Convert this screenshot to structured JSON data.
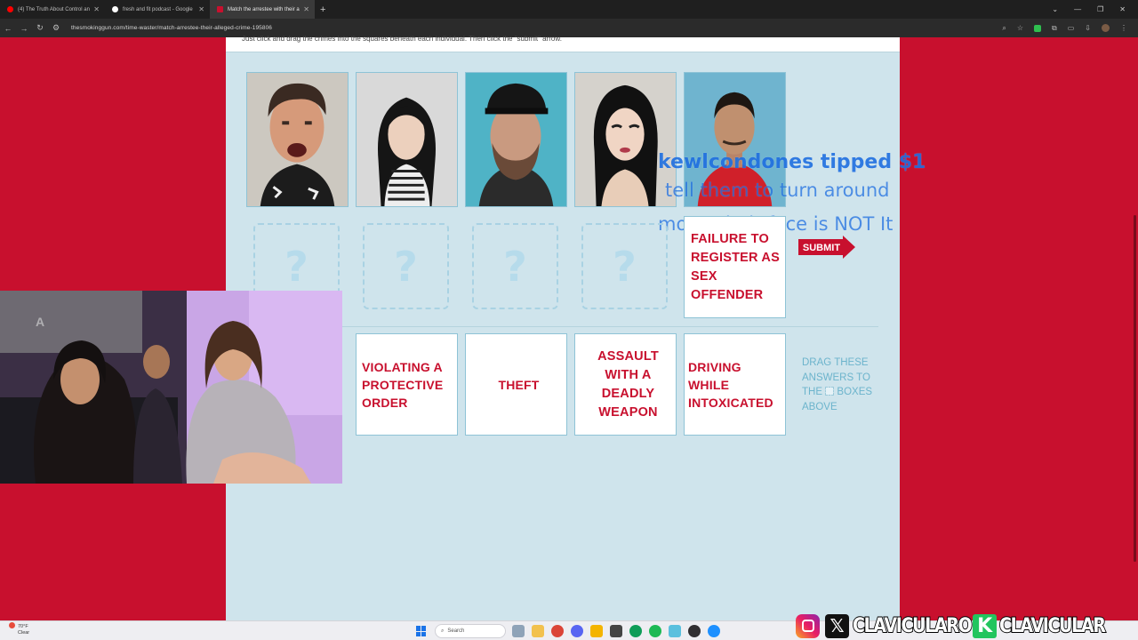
{
  "browser": {
    "tabs": [
      {
        "title": "(4) The Truth About Control an",
        "favicon_color": "#ff0000",
        "active": false
      },
      {
        "title": "fresh and fit podcast - Google",
        "favicon_color": "#ffffff",
        "active": false
      },
      {
        "title": "Match the arrestee with their a",
        "favicon_color": "#c8102e",
        "active": true
      }
    ],
    "new_tab": "+",
    "url": "thesmokinggun.com/time-waster/match-arrestee-their-alleged-crime-195806"
  },
  "page": {
    "instructions": "Just click and drag the crimes into the squares beneath each individual. Then click the \"submit\" arrow.",
    "slot_placeholder": "?",
    "placed_answer": "FAILURE TO REGISTER AS SEX OFFENDER",
    "submit_label": "SUBMIT",
    "answers": [
      "VIOLATING A PROTECTIVE ORDER",
      "THEFT",
      "ASSAULT WITH A DEADLY WEAPON",
      "DRIVING WHILE INTOXICATED"
    ],
    "hint_part1": "DRAG THESE ANSWERS TO THE",
    "hint_part2": "BOXES ABOVE"
  },
  "overlay": {
    "tip_line1": "kewlcondones tipped $1",
    "tip_line2": "tell them to turn around",
    "tip_line3": "more, their face is NOT It"
  },
  "taskbar": {
    "weather_temp": "70°F",
    "weather_cond": "Clear",
    "search_placeholder": "Search"
  },
  "social": {
    "handle1": "CLAVICULARO",
    "handle2": "CLAVICULAR"
  },
  "colors": {
    "brand_red": "#c8102e",
    "content_bg": "#cfe4ec",
    "tip_blue": "#1f6fe0"
  }
}
